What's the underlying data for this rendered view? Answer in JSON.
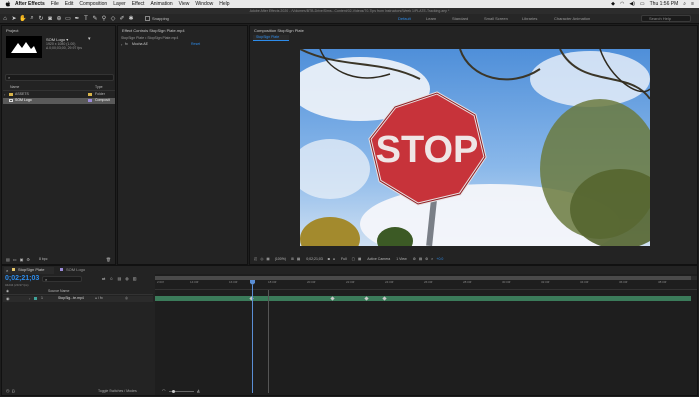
{
  "menubar": {
    "apple": "",
    "app_name": "After Effects",
    "items": [
      "File",
      "Edit",
      "Composition",
      "Layer",
      "Effect",
      "Animation",
      "View",
      "Window",
      "Help"
    ],
    "right": {
      "clock": "Thu 1:56 PM"
    }
  },
  "titlebar": {
    "title": "Adobe After Effects 2020 - /Volumes/BTB-Drive/Sims...Content/02-Videos/70-Tips from Instructors/Week 1/PLATE-Tracking.aep *"
  },
  "toolbar": {
    "snapping_label": "Snapping",
    "workspaces": [
      "Default",
      "Learn",
      "Standard",
      "Small Screen",
      "Libraries",
      "Character Animation"
    ],
    "active_workspace": "Default",
    "search_placeholder": "Search Help"
  },
  "project": {
    "tab_label": "Project",
    "selected_name": "SOM Logo ▾",
    "selected_info": [
      "1920 x 1080 (1.00)",
      "Δ 0;00;03;00, 29.97 fps"
    ],
    "search_icon": "search-icon",
    "col_name": "Name",
    "col_type": "Type",
    "rows": [
      {
        "name": "ASSETS",
        "type": "Folder",
        "label_color": "#d8b44a"
      },
      {
        "name": "SOM Logo",
        "type": "Composit",
        "label_color": "#9b8ad8"
      }
    ],
    "bpc": "8 bpc"
  },
  "effects": {
    "tab_label": "Effect Controls StopSign Plate.mp4",
    "header": "StopSign Plate • StopSign Plate.mp4",
    "effect_name": "Mocha AE",
    "reset_label": "Reset"
  },
  "comp": {
    "tab_label": "Composition StopSign Plate",
    "subtab": "StopSign Plate",
    "viewer_bar": {
      "zoom": "(100%)",
      "timecode": "0;02;21;03",
      "resolution": "Full",
      "camera": "Active Camera",
      "views": "1 View",
      "exposure": "+0.0"
    }
  },
  "timeline": {
    "tabs": [
      "StopSign Plate",
      "SOM Logo"
    ],
    "timecode": "0;02;21;03",
    "frame_info": "04234 (29.97 fps)",
    "source_name_header": "Source Name",
    "layer": {
      "num": "1",
      "name": "StopSig...te.mp4"
    },
    "ruler_labels": [
      "2:00f",
      "14:00f",
      "16:00f",
      "18:00f",
      "20:00f",
      "22:00f",
      "24:00f",
      "26:00f",
      "28:00f",
      "30:00f",
      "32:00f",
      "34:00f",
      "36:00f",
      "38:00f"
    ],
    "toggle_label": "Toggle Switches / Modes",
    "colors": {
      "playhead": "#5a8ed4",
      "layer_bar": "#3b7b5a",
      "keyframe": "#c9c9c9"
    }
  }
}
